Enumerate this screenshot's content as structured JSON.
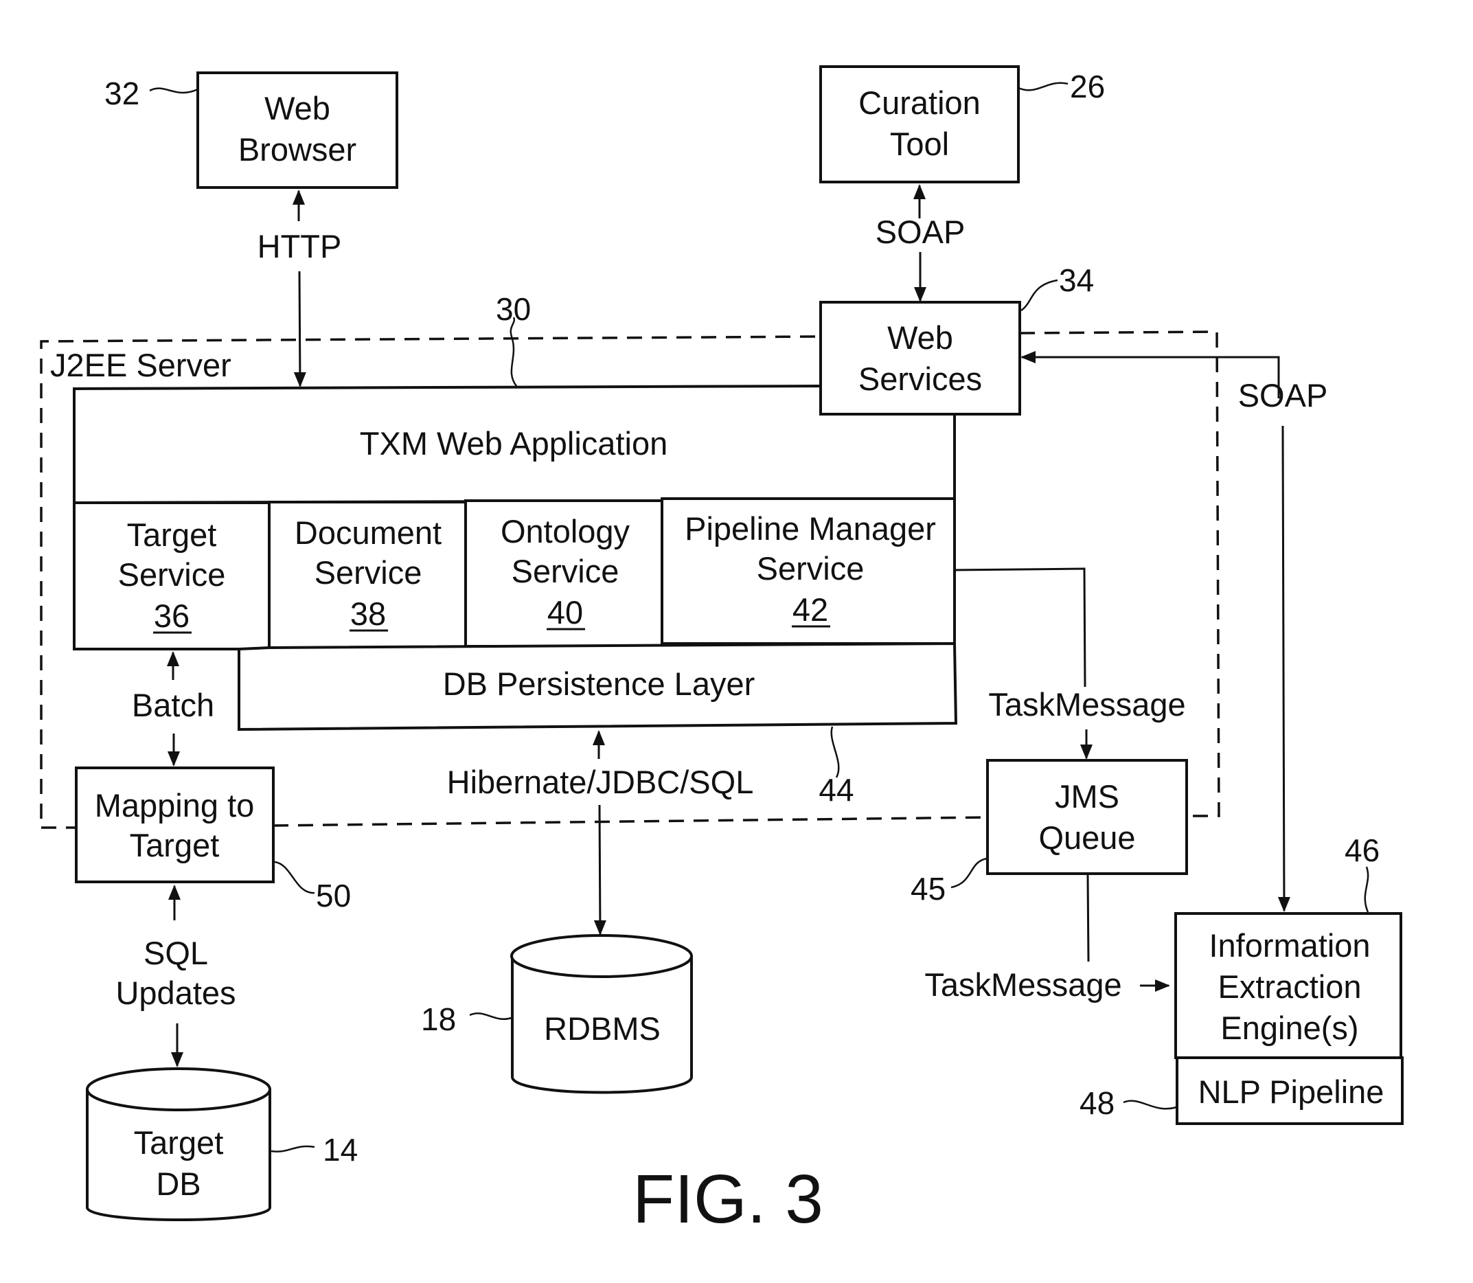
{
  "figure": {
    "caption": "FIG. 3",
    "container": {
      "label": "J2EE Server"
    },
    "components": {
      "web_browser": {
        "lines": [
          "Web",
          "Browser"
        ],
        "ref": "32"
      },
      "curation_tool": {
        "lines": [
          "Curation",
          "Tool"
        ],
        "ref": "26"
      },
      "web_services": {
        "lines": [
          "Web",
          "Services"
        ],
        "ref": "34"
      },
      "txm_app": {
        "title": "TXM Web Application",
        "ref": "30"
      },
      "services": [
        {
          "lines": [
            "Target",
            "Service"
          ],
          "ref": "36"
        },
        {
          "lines": [
            "Document",
            "Service"
          ],
          "ref": "38"
        },
        {
          "lines": [
            "Ontology",
            "Service"
          ],
          "ref": "40"
        },
        {
          "lines": [
            "Pipeline Manager",
            "Service"
          ],
          "ref": "42"
        }
      ],
      "db_layer": {
        "title": "DB Persistence Layer",
        "ref": "44"
      },
      "mapping": {
        "lines": [
          "Mapping to",
          "Target"
        ],
        "ref": "50"
      },
      "target_db": {
        "lines": [
          "Target",
          "DB"
        ],
        "ref": "14"
      },
      "rdbms": {
        "title": "RDBMS",
        "ref": "18"
      },
      "jms_queue": {
        "lines": [
          "JMS",
          "Queue"
        ],
        "ref": "45"
      },
      "ie_engine": {
        "lines": [
          "Information",
          "Extraction",
          "Engine(s)"
        ],
        "ref": "46"
      },
      "nlp": {
        "title": "NLP Pipeline",
        "ref": "48"
      }
    },
    "connections": {
      "http": "HTTP",
      "soap_top": "SOAP",
      "soap_right": "SOAP",
      "batch": "Batch",
      "sql_updates": [
        "SQL",
        "Updates"
      ],
      "hibernate": "Hibernate/JDBC/SQL",
      "taskmessage_1": "TaskMessage",
      "taskmessage_2": "TaskMessage"
    }
  }
}
